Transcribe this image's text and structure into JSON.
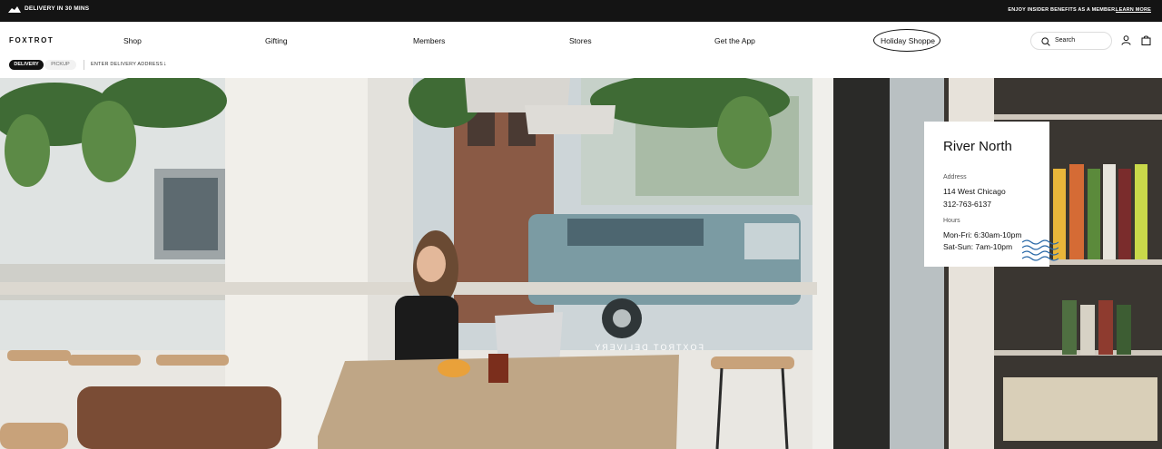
{
  "topbar": {
    "delivery_text": "DELIVERY IN 30 MINS",
    "insider_text": "ENJOY INSIDER BENEFITS AS A MEMBER.",
    "learn_more": "LEARN MORE"
  },
  "header": {
    "logo": "FOXTROT",
    "nav": [
      "Shop",
      "Gifting",
      "Members",
      "Stores",
      "Get the App",
      "Holiday Shoppe"
    ],
    "search_label": "Search",
    "mode_delivery": "DELIVERY",
    "mode_pickup": "PICKUP",
    "address_prompt": "ENTER DELIVERY ADDRESS",
    "address_arrow": "↓"
  },
  "store_card": {
    "name": "River North",
    "address_label": "Address",
    "street": "114 West Chicago",
    "phone": "312-763-6137",
    "hours_label": "Hours",
    "hours_weekday": "Mon-Fri: 6:30am-10pm",
    "hours_weekend": "Sat-Sun: 7am-10pm"
  },
  "hero": {
    "window_lettering": "FOXTROT DELIVERY"
  },
  "colors": {
    "topbar_bg": "#141414",
    "text": "#111111",
    "accent_wave": "#2b6aa8"
  }
}
